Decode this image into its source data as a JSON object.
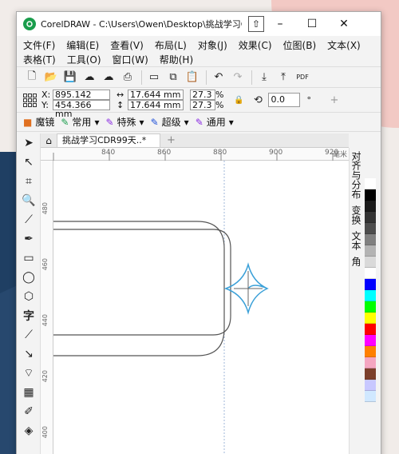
{
  "window": {
    "title": "CorelDRAW - C:\\Users\\Owen\\Desktop\\挑战学习CDR..*",
    "minimize": "–",
    "maximize": "☐",
    "close": "✕"
  },
  "menu": {
    "row1": [
      "文件(F)",
      "编辑(E)",
      "查看(V)",
      "布局(L)",
      "对象(J)",
      "效果(C)",
      "位图(B)",
      "文本(X)"
    ],
    "row2": [
      "表格(T)",
      "工具(O)",
      "窗口(W)",
      "帮助(H)"
    ]
  },
  "props": {
    "x_label": "X:",
    "y_label": "Y:",
    "x_value": "895.142 mm",
    "y_value": "454.366 mm",
    "w_value": "17.644 mm",
    "h_value": "17.644 mm",
    "w_pct": "27.3",
    "h_pct": "27.3",
    "pct_unit": "%",
    "rotation": "0.0",
    "degree": "°"
  },
  "stylebar": {
    "items": [
      "魔镜",
      "常用",
      "特殊",
      "超级",
      "通用"
    ]
  },
  "document": {
    "tab_label": "挑战学习CDR99天..*"
  },
  "rulers": {
    "top_ticks": [
      "840",
      "860",
      "880",
      "900",
      "920",
      "毫米"
    ],
    "left_ticks": [
      "480",
      "460",
      "440",
      "420",
      "400"
    ]
  },
  "dockers": {
    "tabs": [
      "对齐与分布",
      "变换",
      "文本",
      "角"
    ]
  },
  "palette": {
    "colors": [
      "#ffffff",
      "#000000",
      "#1a1a1a",
      "#333333",
      "#4d4d4d",
      "#808080",
      "#b3b3b3",
      "#d9d9d9",
      "#ffffff",
      "#0000ff",
      "#00ffff",
      "#00ff00",
      "#ffff00",
      "#ff0000",
      "#ff00ff",
      "#ff8000",
      "#f4a6c1",
      "#7b3f2b",
      "#c8c8ff",
      "#d0e8ff"
    ]
  }
}
